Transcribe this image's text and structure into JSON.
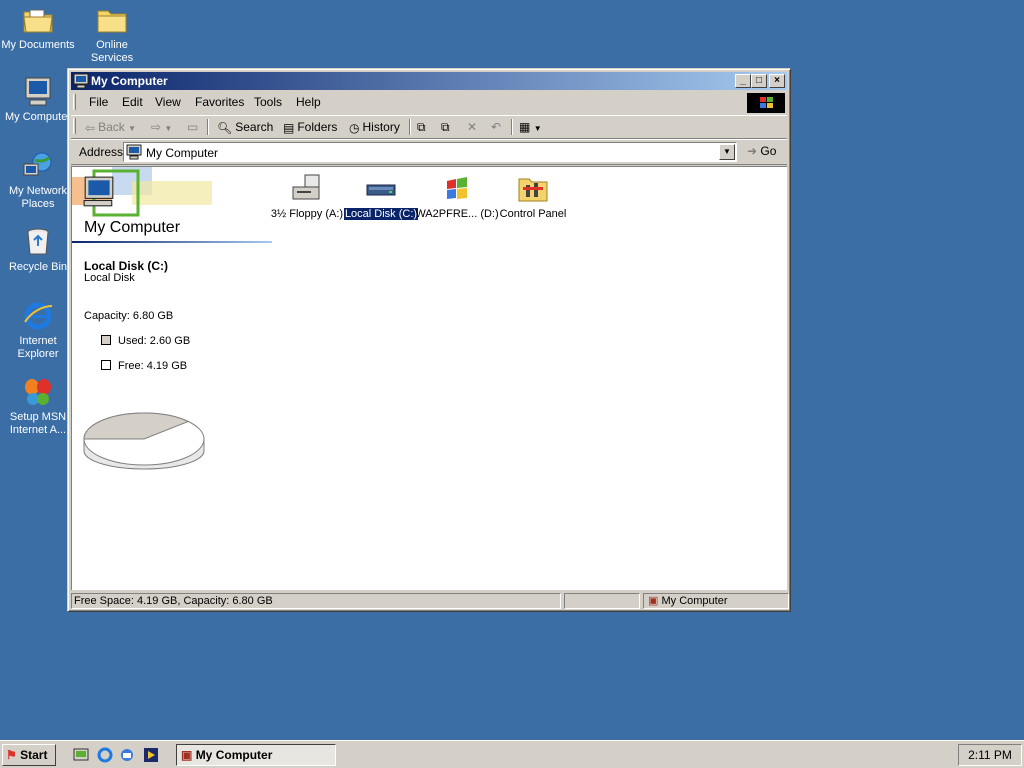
{
  "desktop": {
    "icons": [
      {
        "label": "My Documents"
      },
      {
        "label": "Online Services"
      },
      {
        "label": "My Computer"
      },
      {
        "label": "My Network Places"
      },
      {
        "label": "Recycle Bin"
      },
      {
        "label": "Internet Explorer"
      },
      {
        "label": "Setup MSN Internet A..."
      }
    ]
  },
  "window": {
    "title": "My Computer",
    "menu": [
      "File",
      "Edit",
      "View",
      "Favorites",
      "Tools",
      "Help"
    ],
    "toolbar": {
      "back": "Back",
      "search": "Search",
      "folders": "Folders",
      "history": "History"
    },
    "address": {
      "label": "Address",
      "value": "My Computer",
      "go": "Go"
    },
    "sidebar": {
      "title": "My Computer",
      "drive_name": "Local Disk (C:)",
      "drive_type": "Local Disk",
      "capacity": "Capacity: 6.80 GB",
      "used": "Used: 2.60 GB",
      "free": "Free: 4.19 GB",
      "used_fraction": 0.382
    },
    "drives": [
      {
        "label": "3½ Floppy (A:)",
        "selected": false
      },
      {
        "label": "Local Disk (C:)",
        "selected": true
      },
      {
        "label": "WA2PFRE... (D:)",
        "selected": false
      },
      {
        "label": "Control Panel",
        "selected": false
      }
    ],
    "status": {
      "info": "Free Space: 4.19 GB, Capacity: 6.80 GB",
      "zone": "My Computer"
    }
  },
  "taskbar": {
    "start": "Start",
    "task": "My Computer",
    "clock": "2:11 PM"
  },
  "colors": {
    "desktop": "#3a6ea5",
    "title_active": "#0a246a",
    "title_gradient_end": "#a6caf0",
    "selection": "#0a246a",
    "face": "#d4d0c8"
  }
}
